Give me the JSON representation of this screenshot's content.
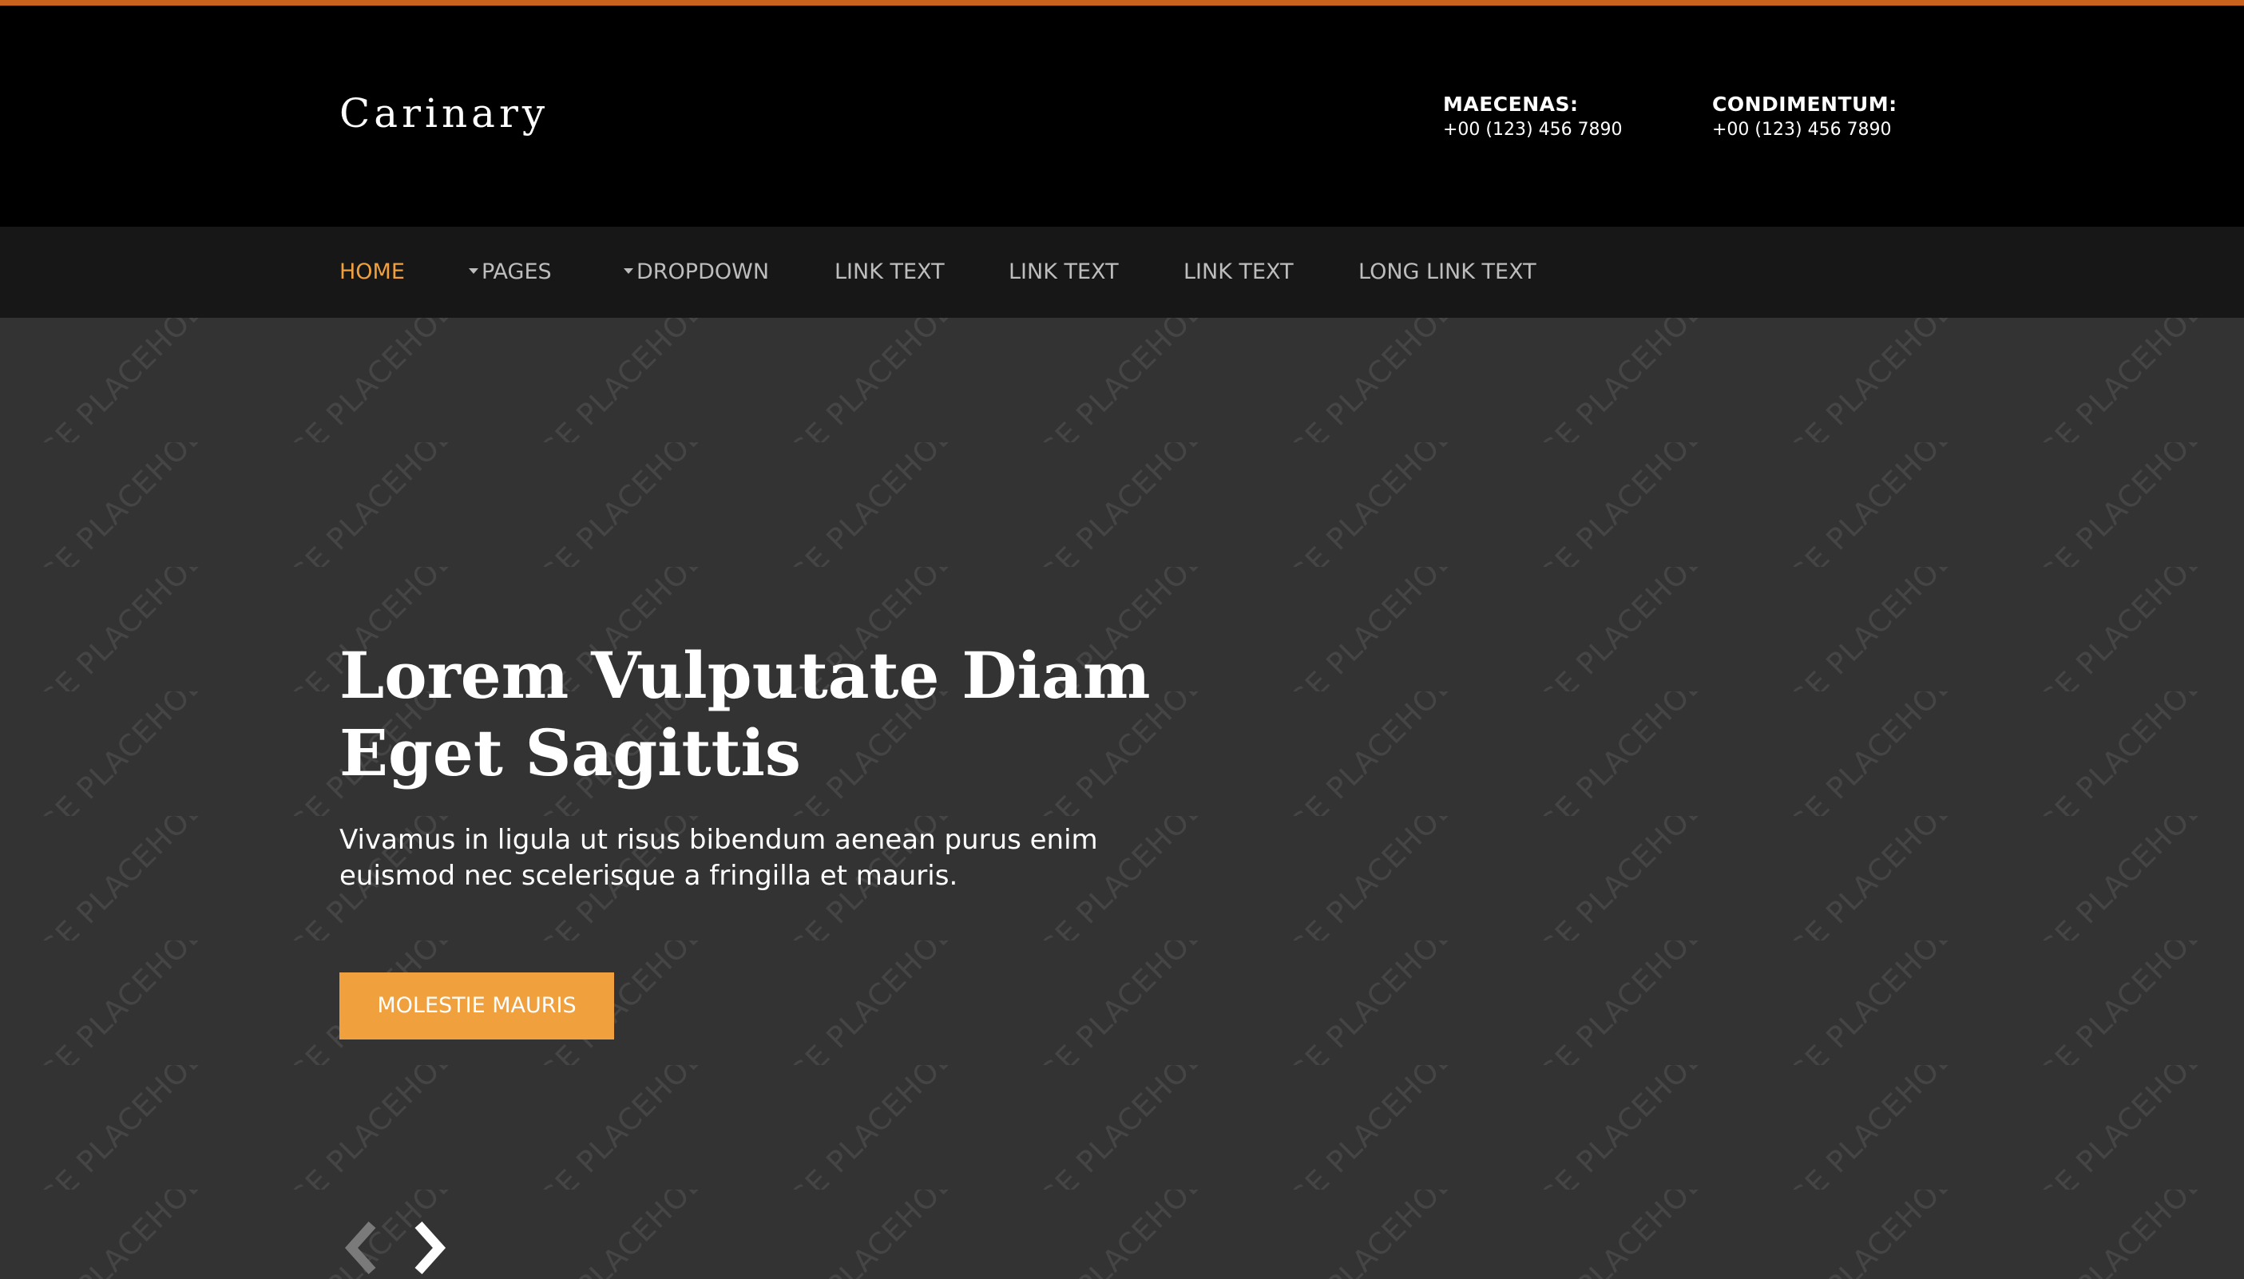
{
  "brand": {
    "name": "Carinary"
  },
  "contacts": [
    {
      "label": "MAECENAS:",
      "phone": "+00 (123) 456 7890"
    },
    {
      "label": "CONDIMENTUM:",
      "phone": "+00 (123) 456 7890"
    }
  ],
  "nav": {
    "items": [
      {
        "label": "HOME",
        "active": true
      },
      {
        "label": "PAGES",
        "dropdown": true
      },
      {
        "label": "DROPDOWN",
        "dropdown": true
      },
      {
        "label": "LINK TEXT"
      },
      {
        "label": "LINK TEXT"
      },
      {
        "label": "LINK TEXT"
      },
      {
        "label": "LONG LINK TEXT"
      }
    ]
  },
  "hero": {
    "watermark_text": "IMAGE PLACEHOLDER",
    "title_line1": "Lorem Vulputate Diam",
    "title_line2": "Eget Sagittis",
    "text_line1": "Vivamus in ligula ut risus bibendum aenean purus enim",
    "text_line2": "euismod nec scelerisque a fringilla et mauris.",
    "button_label": "MOLESTIE MAURIS"
  },
  "slider": {
    "prev_icon": "chevron-left-icon",
    "next_icon": "chevron-right-icon"
  },
  "colors": {
    "accent": "#f0a03d",
    "top_border": "#c9621c",
    "header_bg": "#000000",
    "nav_bg": "#171717",
    "hero_bg": "#333333"
  }
}
